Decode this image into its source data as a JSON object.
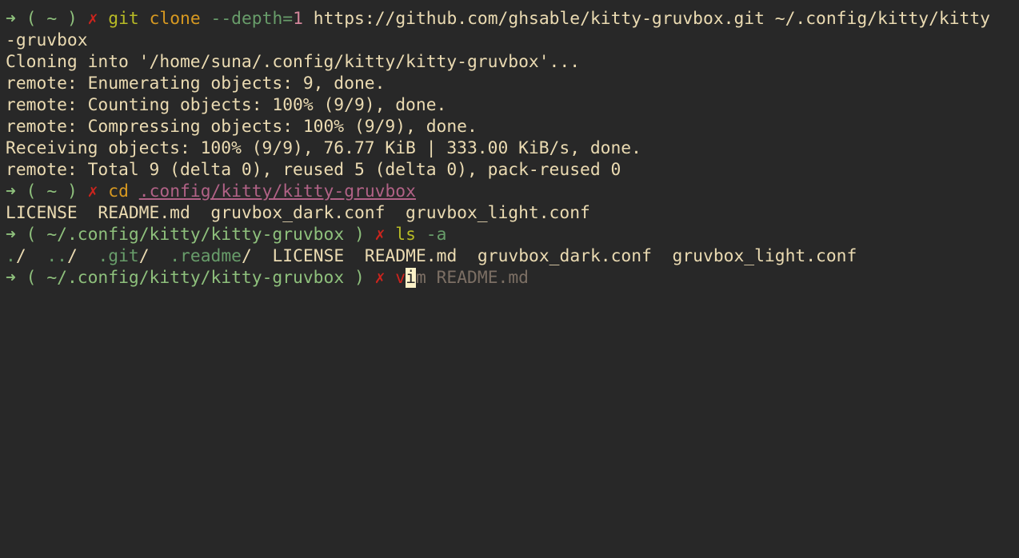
{
  "colors": {
    "background": "#282828",
    "foreground": "#ebdbb2",
    "prompt_green": "#8ec07c",
    "error_red": "#cc241d",
    "command_yellow": "#b8bb26",
    "path_purple": "#b16286",
    "suggestion_gray": "#7c6f64"
  },
  "prompt": {
    "arrow": "➜",
    "open": "(",
    "close": ")",
    "status": "✗"
  },
  "lines": {
    "l1": {
      "cwd": "~",
      "cmd": "git",
      "sub": "clone",
      "opt": "--depth",
      "eq": "=",
      "val": "1",
      "arg": "https://github.com/ghsable/kitty-gruvbox.git ~/.config/kitty/kitty"
    },
    "l2": "-gruvbox",
    "l3": "Cloning into '/home/suna/.config/kitty/kitty-gruvbox'...",
    "l4": "remote: Enumerating objects: 9, done.",
    "l5": "remote: Counting objects: 100% (9/9), done.",
    "l6": "remote: Compressing objects: 100% (9/9), done.",
    "l7": "Receiving objects: 100% (9/9), 76.77 KiB | 333.00 KiB/s, done.",
    "l8": "remote: Total 9 (delta 0), reused 5 (delta 0), pack-reused 0",
    "l9": {
      "cwd": "~",
      "cmd": "cd",
      "arg": ".config/kitty/kitty-gruvbox"
    },
    "l10": "LICENSE  README.md  gruvbox_dark.conf  gruvbox_light.conf",
    "l11": {
      "cwd": "~/.config/kitty/kitty-gruvbox",
      "cmd": "ls",
      "arg": "-a"
    },
    "l12": {
      "items": [
        {
          "name": ".",
          "slash": "/"
        },
        {
          "name": "..",
          "slash": "/"
        },
        {
          "name": ".git",
          "slash": "/"
        },
        {
          "name": ".readme",
          "slash": "/"
        }
      ],
      "files": "LICENSE  README.md  gruvbox_dark.conf  gruvbox_light.conf"
    },
    "l13": {
      "cwd": "~/.config/kitty/kitty-gruvbox",
      "typed": "v",
      "cursor_char": "i",
      "suggestion": "m README.md"
    }
  }
}
